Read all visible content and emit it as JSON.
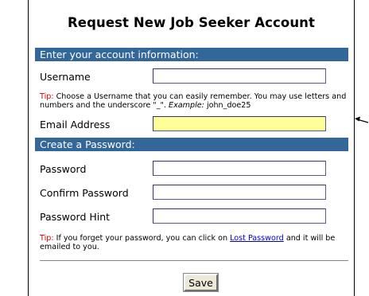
{
  "title": "Request New Job Seeker Account",
  "sections": {
    "account_info": "Enter your account information:",
    "password": "Create a Password:"
  },
  "fields": {
    "username": {
      "label": "Username",
      "value": ""
    },
    "email": {
      "label": "Email Address",
      "value": ""
    },
    "password": {
      "label": "Password",
      "value": ""
    },
    "confirm_password": {
      "label": "Confirm Password",
      "value": ""
    },
    "password_hint": {
      "label": "Password Hint",
      "value": ""
    }
  },
  "tips": {
    "label": "Tip:",
    "username_text": " Choose a Username that you can easily remember. You may use letters and numbers and the underscore \"_\". ",
    "username_example_label": "Example:",
    "username_example_value": " john_doe25",
    "password_text_before": " If you forget your password, you can click on ",
    "password_link": "Lost Password",
    "password_text_after": " and it will be emailed to you."
  },
  "save_label": "Save",
  "colors": {
    "section_bar": "#336699",
    "highlight_field": "#ffff99",
    "tip_label": "#cc0000",
    "link": "#0000cc"
  },
  "icons": {
    "pointer": "arrow-left-icon"
  }
}
